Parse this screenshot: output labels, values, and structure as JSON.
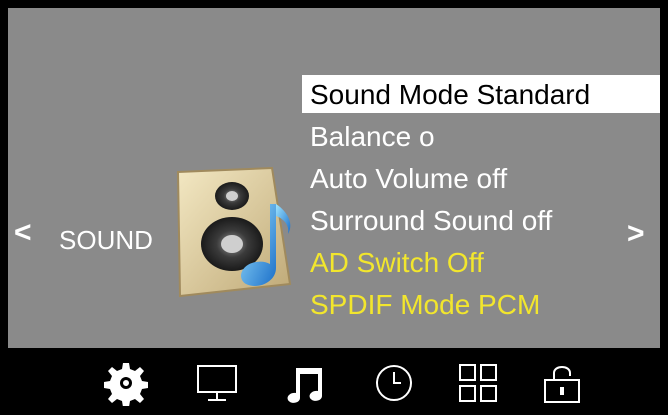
{
  "nav": {
    "left_arrow": "<",
    "right_arrow": ">"
  },
  "section": {
    "title": "SOUND",
    "icon": "speaker-music-note-icon"
  },
  "menu": {
    "items": [
      {
        "label": "Sound Mode Standard",
        "state": "selected"
      },
      {
        "label": "Balance o",
        "state": "normal"
      },
      {
        "label": "Auto Volume off",
        "state": "normal"
      },
      {
        "label": "Surround Sound off",
        "state": "normal"
      },
      {
        "label": "AD Switch Off",
        "state": "highlighted-yellow"
      },
      {
        "label": "SPDIF Mode PCM",
        "state": "highlighted-yellow"
      }
    ]
  },
  "tabs": [
    {
      "name": "settings",
      "icon": "gear-icon",
      "active": false
    },
    {
      "name": "picture",
      "icon": "monitor-icon",
      "active": false
    },
    {
      "name": "sound",
      "icon": "music-note-icon",
      "active": true
    },
    {
      "name": "time",
      "icon": "clock-icon",
      "active": false
    },
    {
      "name": "channel",
      "icon": "grid-icon",
      "active": false
    },
    {
      "name": "lock",
      "icon": "lock-icon",
      "active": false
    }
  ],
  "colors": {
    "background": "#8a8a8a",
    "highlight": "#ffffff",
    "yellow_text": "#f2e62d",
    "bar": "#000000"
  }
}
